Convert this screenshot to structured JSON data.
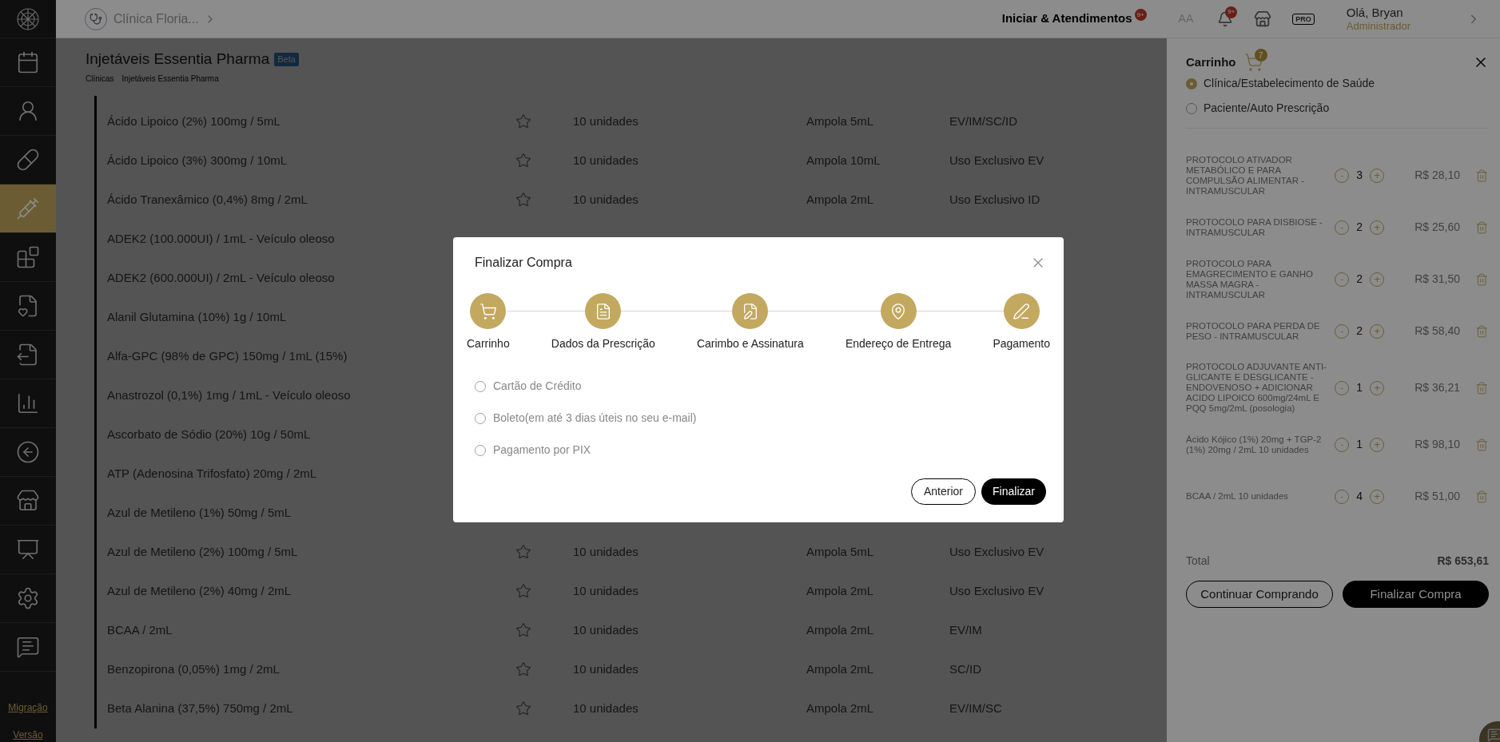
{
  "sidebar": {
    "items": [
      {
        "selected": false
      },
      {
        "selected": false
      },
      {
        "selected": false
      },
      {
        "selected": true
      },
      {
        "selected": false
      },
      {
        "selected": false
      },
      {
        "selected": false
      },
      {
        "selected": false
      },
      {
        "selected": false
      },
      {
        "selected": false
      },
      {
        "selected": false
      },
      {
        "selected": false
      },
      {
        "selected": false
      }
    ],
    "links": [
      "Migração",
      "Versão"
    ]
  },
  "topbar": {
    "clinic": "Clínica Floria...",
    "actions_label": "Iniciar & Atendimentos",
    "actions_badge": "9+",
    "font_button": "AA",
    "notifications_badge": "9+",
    "plan_badge": "PRO",
    "greeting": "Olá, Bryan",
    "role": "Administrador"
  },
  "page": {
    "title": "Injetáveis Essentia Pharma",
    "badge": "Beta",
    "breadcrumb": [
      "Clínicas",
      "Injetáveis Essentia Pharma"
    ]
  },
  "products": [
    {
      "name": "Ácido Lipoico (2%) 100mg / 5mL",
      "favorite": false,
      "quantity": "10 unidades",
      "presentation": "Ampola 5mL",
      "route": "EV/IM/SC/ID"
    },
    {
      "name": "Ácido Lipoico (3%) 300mg / 10mL",
      "favorite": false,
      "quantity": "10 unidades",
      "presentation": "Ampola 10mL",
      "route": "Uso Exclusivo EV"
    },
    {
      "name": "Ácido Tranexâmico (0,4%) 8mg / 2mL",
      "favorite": false,
      "quantity": "10 unidades",
      "presentation": "Ampola 2mL",
      "route": "Uso Exclusivo ID"
    },
    {
      "name": "ADEK2 (100.000UI) / 1mL - Veículo oleoso"
    },
    {
      "name": "ADEK2 (600.000UI) / 2mL - Veículo oleoso"
    },
    {
      "name": "Alanil Glutamina (10%) 1g / 10mL"
    },
    {
      "name": "Alfa-GPC (98% de GPC) 150mg / 1mL (15%)"
    },
    {
      "name": "Anastrozol (0,1%) 1mg / 1mL - Veículo oleoso"
    },
    {
      "name": "Ascorbato de Sódio (20%) 10g / 50mL"
    },
    {
      "name": "ATP (Adenosina Trifosfato) 20mg / 2mL"
    },
    {
      "name": "Azul de Metileno (1%) 50mg / 5mL"
    },
    {
      "name": "Azul de Metileno (2%) 100mg / 5mL",
      "favorite": false,
      "quantity": "10 unidades",
      "presentation": "Ampola 5mL",
      "route": "Uso Exclusivo EV"
    },
    {
      "name": "Azul de Metileno (2%) 40mg / 2mL",
      "favorite": false,
      "quantity": "10 unidades",
      "presentation": "Ampola 2mL",
      "route": "Uso Exclusivo EV"
    },
    {
      "name": "BCAA / 2mL",
      "favorite": false,
      "quantity": "10 unidades",
      "presentation": "Ampola 2mL",
      "route": "EV/IM"
    },
    {
      "name": "Benzopirona (0,05%) 1mg / 2mL",
      "favorite": false,
      "quantity": "10 unidades",
      "presentation": "Ampola 2mL",
      "route": "SC/ID"
    },
    {
      "name": "Beta Alanina (37,5%) 750mg / 2mL",
      "favorite": false,
      "quantity": "10 unidades",
      "presentation": "Ampola 2mL",
      "route": "EV/IM/SC"
    }
  ],
  "cart": {
    "title": "Carrinho",
    "count": "7",
    "prescriber_options": [
      {
        "label": "Clínica/Estabelecimento de Saúde",
        "selected": true
      },
      {
        "label": "Paciente/Auto Prescrição",
        "selected": false
      }
    ],
    "items": [
      {
        "name": "PROTOCOLO ATIVADOR METABÓLICO E PARA COMPULSÃO ALIMENTAR - INTRAMUSCULAR",
        "minus": "-",
        "quantity": "3",
        "plus": "+",
        "price": "R$ 28,10"
      },
      {
        "name": "PROTOCOLO PARA DISBIOSE - INTRAMUSCULAR",
        "minus": "-",
        "quantity": "2",
        "plus": "+",
        "price": "R$ 25,60"
      },
      {
        "name": "PROTOCOLO PARA EMAGRECIMENTO E GANHO MASSA MAGRA - INTRAMUSCULAR",
        "minus": "-",
        "quantity": "2",
        "plus": "+",
        "price": "R$ 31,50"
      },
      {
        "name": "PROTOCOLO PARA PERDA DE PESO - INTRAMUSCULAR",
        "minus": "-",
        "quantity": "2",
        "plus": "+",
        "price": "R$ 58,40"
      },
      {
        "name": "PROTOCOLO ADJUVANTE ANTI-GLICANTE E DESGLICANTE - ENDOVENOSO + ADICIONAR ACIDO LIPOICO 600mg/24mL E PQQ 5mg/2mL (posologia)",
        "minus": "-",
        "quantity": "1",
        "plus": "+",
        "price": "R$ 36,21"
      },
      {
        "name": "Ácido Kójico (1%) 20mg + TGP-2 (1%) 20mg / 2mL 10 unidades",
        "minus": "-",
        "quantity": "1",
        "plus": "+",
        "price": "R$ 98,10"
      },
      {
        "name": "BCAA / 2mL 10 unidades",
        "minus": "-",
        "quantity": "4",
        "plus": "+",
        "price": "R$ 51,00"
      }
    ],
    "total_label": "Total",
    "total": "R$ 653,61",
    "buttons": [
      "Continuar Comprando",
      "Finalizar Compra"
    ]
  },
  "modal": {
    "title": "Finalizar Compra",
    "steps": [
      {
        "label": "Carrinho"
      },
      {
        "label": "Dados da Prescrição"
      },
      {
        "label": "Carimbo e Assinatura"
      },
      {
        "label": "Endereço de Entrega"
      },
      {
        "label": "Pagamento"
      }
    ],
    "payment_options": [
      {
        "label": "Cartão de Crédito",
        "selected": false
      },
      {
        "label": "Boleto(em até 3 dias úteis no seu e-mail)",
        "selected": false
      },
      {
        "label": "Pagamento por PIX",
        "selected": false
      }
    ],
    "buttons": [
      "Anterior",
      "Finalizar"
    ]
  }
}
